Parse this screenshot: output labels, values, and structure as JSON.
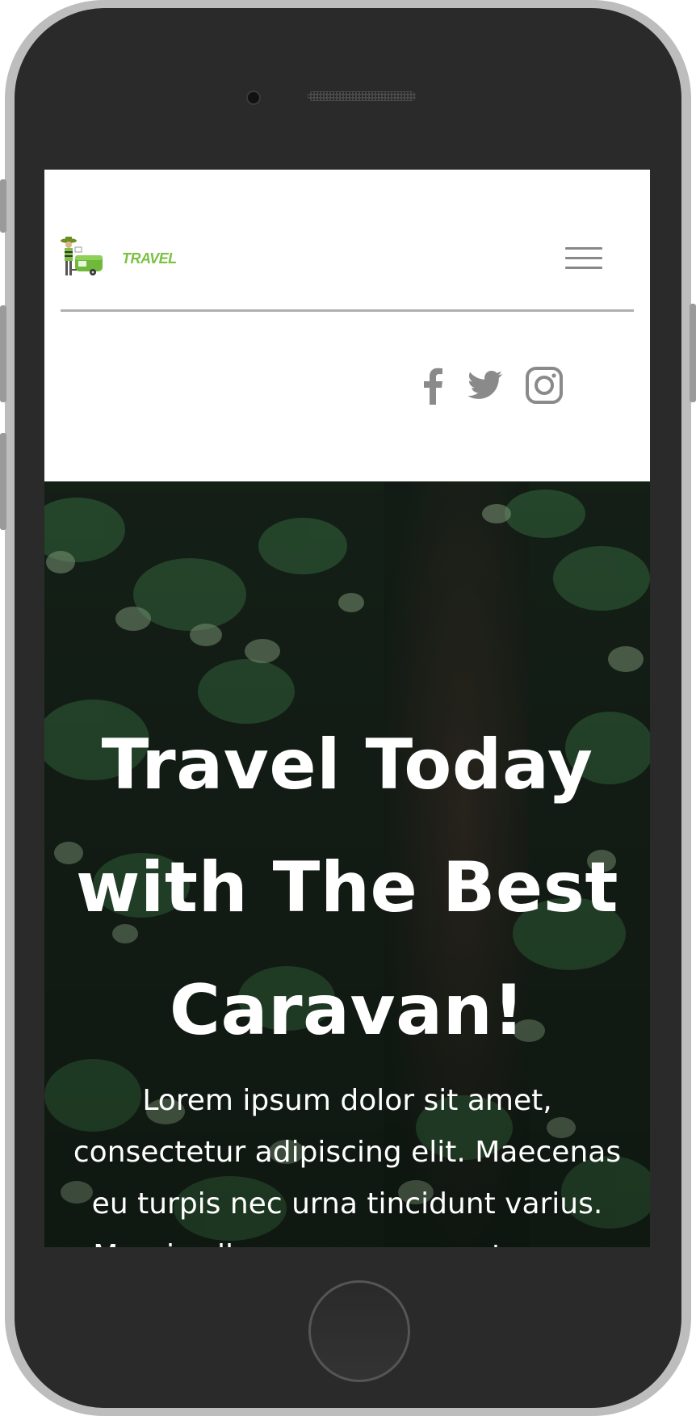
{
  "logo": {
    "text": "TRAVEL"
  },
  "nav": {
    "menu_icon": "hamburger-icon"
  },
  "social": [
    {
      "icon": "facebook-icon"
    },
    {
      "icon": "twitter-icon"
    },
    {
      "icon": "instagram-icon"
    }
  ],
  "hero": {
    "title": "Travel Today with The Best Caravan!",
    "text": "Lorem ipsum dolor sit amet, consectetur adipiscing elit. Maecenas eu turpis nec urna tincidunt varius. Mauris ullamcorper, arcu a tempus"
  },
  "colors": {
    "brand_green": "#7cc142",
    "icon_gray": "#888888",
    "hero_text": "#ffffff"
  }
}
